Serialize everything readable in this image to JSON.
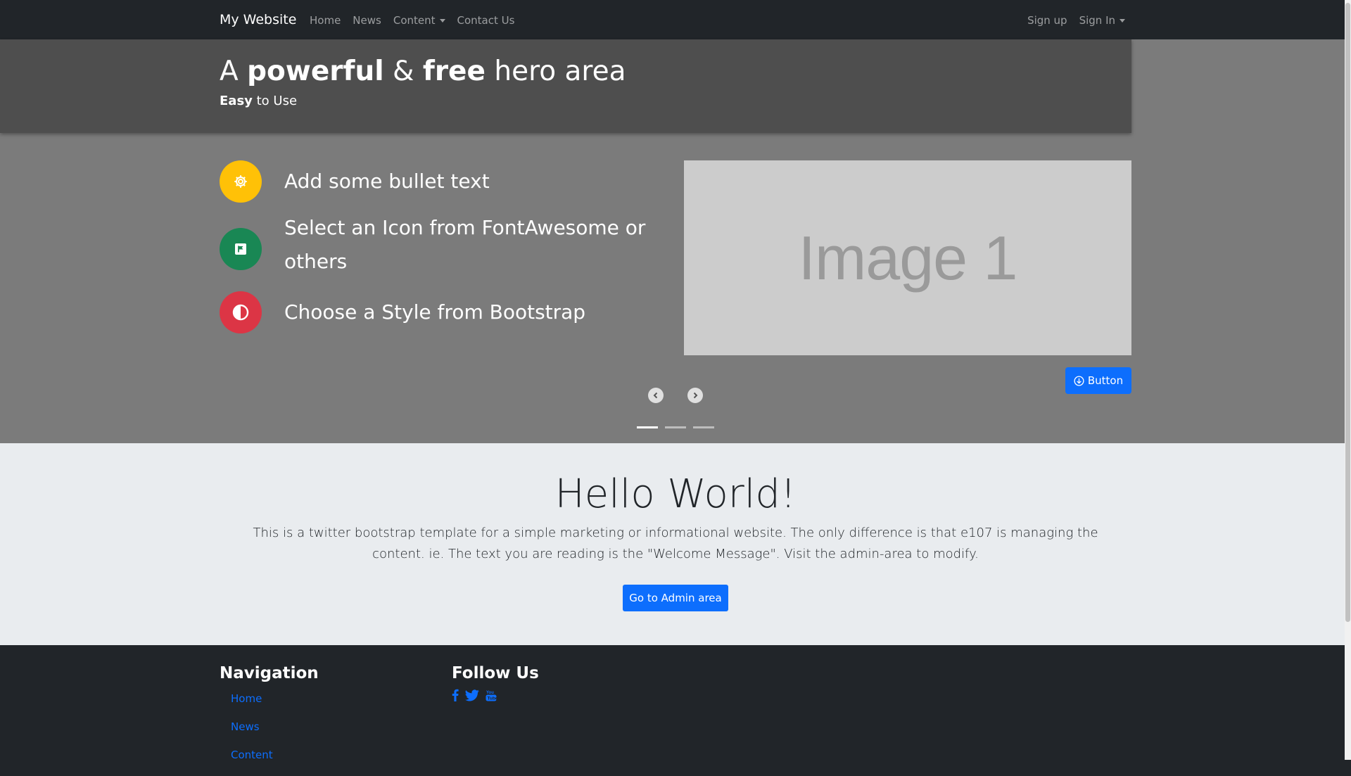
{
  "navbar": {
    "brand": "My Website",
    "left_links": [
      "Home",
      "News",
      "Content",
      "Contact Us"
    ],
    "right_links": [
      "Sign up",
      "Sign In"
    ]
  },
  "hero": {
    "title_prefix": "A",
    "title_bold1": "powerful",
    "title_amp": "&",
    "title_bold2": "free",
    "title_suffix": "hero area",
    "sub_bold": "Easy",
    "sub_rest": "to Use"
  },
  "carousel": {
    "bullets": [
      {
        "text": "Add some bullet text",
        "icon": "gear-icon",
        "color": "#ffc107"
      },
      {
        "text": "Select an Icon from FontAwesome or others",
        "icon": "flag-icon",
        "color": "#198754"
      },
      {
        "text": "Choose a Style from Bootstrap",
        "icon": "adjust-icon",
        "color": "#dc3545"
      }
    ],
    "image_label": "Image 1",
    "button_label": "Button",
    "indicators": 3,
    "active_indicator": 1
  },
  "welcome": {
    "heading": "Hello World!",
    "text": "This is a twitter bootstrap template for a simple marketing or informational website. The only difference is that e107 is managing the content. ie. The text you are reading is the \"Welcome Message\". Visit the admin-area to modify.",
    "button_label": "Go to Admin area"
  },
  "footer": {
    "nav_heading": "Navigation",
    "nav_links": [
      "Home",
      "News",
      "Content"
    ],
    "follow_heading": "Follow Us",
    "social_icons": [
      "facebook-icon",
      "twitter-icon",
      "youtube-icon"
    ]
  },
  "colors": {
    "dark": "#212529",
    "primary": "#0d6efd",
    "hero_header": "#4e4e4e",
    "carousel_bg": "#7b7b7b",
    "light_section": "#e9ecef"
  }
}
